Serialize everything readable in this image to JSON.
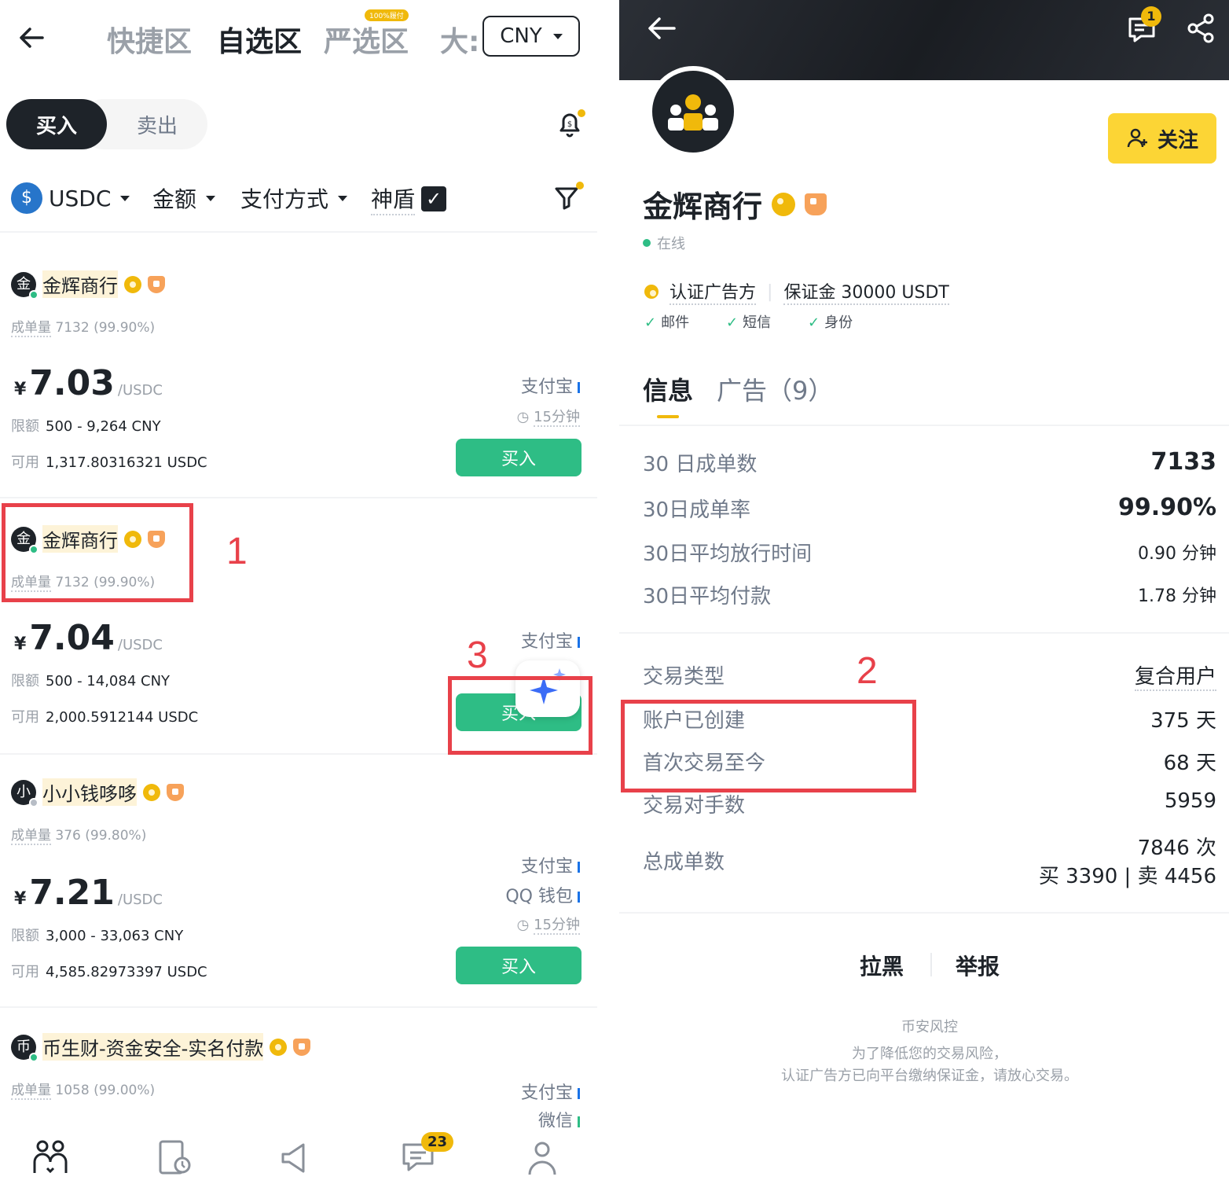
{
  "left": {
    "top_tabs": [
      "快捷区",
      "自选区",
      "严选区",
      "大:"
    ],
    "top_badge": "100%履付",
    "currency": "CNY",
    "side_toggle": {
      "buy": "买入",
      "sell": "卖出"
    },
    "filters": {
      "coin": "USDC",
      "amount": "金额",
      "payment": "支付方式",
      "shield": "神盾"
    },
    "listings": [
      {
        "avatar_char": "金",
        "name": "金辉商行",
        "stat_label": "成单量",
        "stat_value": "7132 (99.90%)",
        "yen": "¥",
        "price": "7.03",
        "unit": "/USDC",
        "limit_label": "限额",
        "limit_value": "500 - 9,264 CNY",
        "avail_label": "可用",
        "avail_value": "1,317.80316321 USDC",
        "payments": [
          "支付宝"
        ],
        "time": "15分钟",
        "button": "买入"
      },
      {
        "avatar_char": "金",
        "name": "金辉商行",
        "stat_label": "成单量",
        "stat_value": "7132 (99.90%)",
        "yen": "¥",
        "price": "7.04",
        "unit": "/USDC",
        "limit_label": "限额",
        "limit_value": "500 - 14,084 CNY",
        "avail_label": "可用",
        "avail_value": "2,000.5912144 USDC",
        "payments": [
          "支付宝"
        ],
        "button": "买入"
      },
      {
        "avatar_char": "小",
        "name": "小小钱哆哆",
        "stat_label": "成单量",
        "stat_value": "376 (99.80%)",
        "yen": "¥",
        "price": "7.21",
        "unit": "/USDC",
        "limit_label": "限额",
        "limit_value": "3,000 - 33,063 CNY",
        "avail_label": "可用",
        "avail_value": "4,585.82973397 USDC",
        "payments": [
          "支付宝",
          "QQ 钱包"
        ],
        "time": "15分钟",
        "button": "买入"
      },
      {
        "avatar_char": "币",
        "name": "币生财-资金安全-实名付款",
        "stat_label": "成单量",
        "stat_value": "1058 (99.00%)",
        "payments": [
          "支付宝",
          "微信"
        ]
      }
    ],
    "annotations": {
      "n1": "1",
      "n3": "3"
    },
    "nav_badge": "23"
  },
  "right": {
    "notif_count": "1",
    "follow": "关注",
    "name": "金辉商行",
    "status": "在线",
    "tag_verified": "认证广告方",
    "tag_deposit": "保证金 30000 USDT",
    "verifications": [
      "邮件",
      "短信",
      "身份"
    ],
    "tabs": {
      "info": "信息",
      "ads": "广告（9）"
    },
    "stats": [
      {
        "label": "30 日成单数",
        "value": "7133"
      },
      {
        "label": "30日成单率",
        "value": "99.90%"
      },
      {
        "label": "30日平均放行时间",
        "value": "0.90 分钟"
      },
      {
        "label": "30日平均付款",
        "value": "1.78 分钟"
      }
    ],
    "details": [
      {
        "label": "交易类型",
        "value": "复合用户"
      },
      {
        "label": "账户已创建",
        "value": "375 天"
      },
      {
        "label": "首次交易至今",
        "value": "68 天"
      },
      {
        "label": "交易对手数",
        "value": "5959"
      },
      {
        "label": "总成单数",
        "value": "7846 次",
        "sub": "买 3390 | 卖 4456"
      }
    ],
    "actions": {
      "block": "拉黑",
      "report": "举报"
    },
    "disclaimer": [
      "币安风控",
      "为了降低您的交易风险，",
      "认证广告方已向平台缴纳保证金，请放心交易。"
    ],
    "annotations": {
      "n2": "2"
    }
  },
  "colors": {
    "green": "#2ebd85",
    "gold": "#f0b90b",
    "yellow_btn": "#fcd535",
    "red_annotation": "#e8414a",
    "text": "#1e2329",
    "muted": "#9aa0a8"
  }
}
